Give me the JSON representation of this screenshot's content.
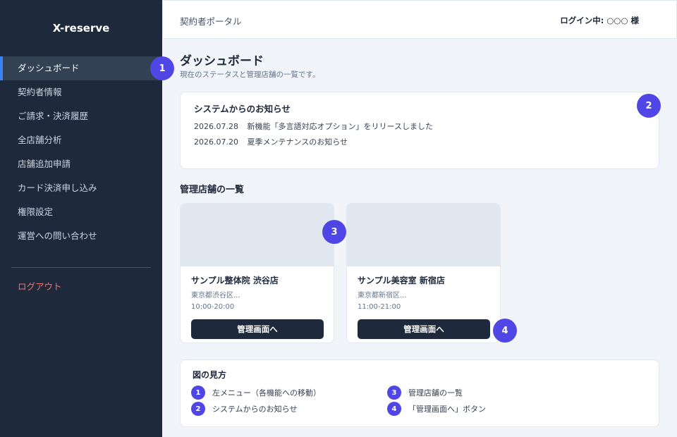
{
  "sidebar": {
    "brand": "X-reserve",
    "items": [
      {
        "label": "ダッシュボード"
      },
      {
        "label": "契約者情報"
      },
      {
        "label": "ご請求・決済履歴"
      },
      {
        "label": "全店舗分析"
      },
      {
        "label": "店舗追加申請"
      },
      {
        "label": "カード決済申し込み"
      },
      {
        "label": "権限設定"
      },
      {
        "label": "運営への問い合わせ"
      }
    ],
    "logout": "ログアウト"
  },
  "header": {
    "title": "契約者ポータル",
    "user": "ログイン中: ○○○ 様"
  },
  "main": {
    "title": "ダッシュボード",
    "subtitle": "現在のステータスと管理店舗の一覧です。",
    "notices": {
      "title": "システムからのお知らせ",
      "items": [
        {
          "date": "2026.07.28",
          "text": "新機能「多言語対応オプション」をリリースしました"
        },
        {
          "date": "2026.07.20",
          "text": "夏季メンテナンスのお知らせ"
        }
      ]
    },
    "stores_title": "管理店舗の一覧",
    "stores": [
      {
        "name": "サンプル整体院 渋谷店",
        "address": "東京都渋谷区...",
        "hours": "10:00-20:00",
        "button": "管理画面へ"
      },
      {
        "name": "サンプル美容室 新宿店",
        "address": "東京都新宿区...",
        "hours": "11:00-21:00",
        "button": "管理画面へ"
      }
    ]
  },
  "legend": {
    "title": "図の見方",
    "items": [
      {
        "num": "1",
        "text": "左メニュー（各機能への移動）"
      },
      {
        "num": "2",
        "text": "システムからのお知らせ"
      },
      {
        "num": "3",
        "text": "管理店舗の一覧"
      },
      {
        "num": "4",
        "text": "「管理画面へ」ボタン"
      }
    ]
  },
  "markers": [
    "1",
    "2",
    "3",
    "4"
  ],
  "colors": {
    "sidebar_bg": "#1e293b",
    "accent": "#3b82f6",
    "marker": "#4f46e5",
    "logout": "#f87171",
    "page_bg": "#f1f4f8"
  }
}
